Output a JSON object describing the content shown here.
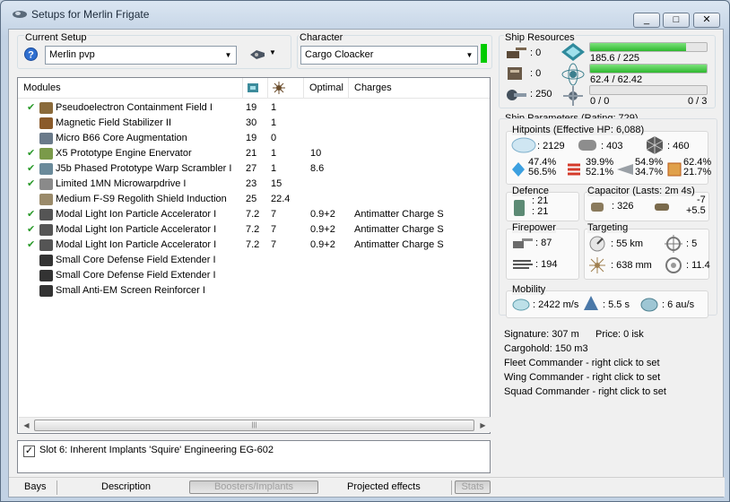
{
  "window": {
    "title": "Setups for Merlin Frigate",
    "min_label": "▭",
    "max_label": "▢",
    "close_label": "✕"
  },
  "setup": {
    "group_label": "Current Setup",
    "help_icon": "question-icon",
    "selected": "Merlin pvp"
  },
  "character": {
    "group_label": "Character",
    "selected": "Cargo Cloacker",
    "status_color": "#00cc00"
  },
  "modules": {
    "headers": {
      "name": "Modules",
      "col1": "",
      "col2": "",
      "optimal": "Optimal",
      "charges": "Charges"
    },
    "rows": [
      {
        "active": true,
        "icon": "module-icon",
        "name": "Pseudoelectron Containment Field I",
        "c1": "19",
        "c2": "1",
        "optimal": "",
        "charges": ""
      },
      {
        "active": false,
        "icon": "module-icon",
        "name": "Magnetic Field Stabilizer II",
        "c1": "30",
        "c2": "1",
        "optimal": "",
        "charges": ""
      },
      {
        "active": false,
        "icon": "module-icon",
        "name": "Micro B66 Core Augmentation",
        "c1": "19",
        "c2": "0",
        "optimal": "",
        "charges": ""
      },
      {
        "active": true,
        "icon": "module-icon",
        "name": "X5 Prototype Engine Enervator",
        "c1": "21",
        "c2": "1",
        "optimal": "10",
        "charges": ""
      },
      {
        "active": true,
        "icon": "module-icon",
        "name": "J5b Phased Prototype Warp Scrambler I",
        "c1": "27",
        "c2": "1",
        "optimal": "8.6",
        "charges": ""
      },
      {
        "active": true,
        "icon": "module-icon",
        "name": "Limited 1MN Microwarpdrive I",
        "c1": "23",
        "c2": "15",
        "optimal": "",
        "charges": ""
      },
      {
        "active": false,
        "icon": "module-icon",
        "name": "Medium F-S9 Regolith Shield Induction",
        "c1": "25",
        "c2": "22.4",
        "optimal": "",
        "charges": ""
      },
      {
        "active": true,
        "icon": "module-icon",
        "name": "Modal Light Ion Particle Accelerator I",
        "c1": "7.2",
        "c2": "7",
        "optimal": "0.9+2",
        "charges": "Antimatter Charge S"
      },
      {
        "active": true,
        "icon": "module-icon",
        "name": "Modal Light Ion Particle Accelerator I",
        "c1": "7.2",
        "c2": "7",
        "optimal": "0.9+2",
        "charges": "Antimatter Charge S"
      },
      {
        "active": true,
        "icon": "module-icon",
        "name": "Modal Light Ion Particle Accelerator I",
        "c1": "7.2",
        "c2": "7",
        "optimal": "0.9+2",
        "charges": "Antimatter Charge S"
      },
      {
        "active": false,
        "icon": "module-icon",
        "name": "Small Core Defense Field Extender I",
        "c1": "",
        "c2": "",
        "optimal": "",
        "charges": ""
      },
      {
        "active": false,
        "icon": "module-icon",
        "name": "Small Core Defense Field Extender I",
        "c1": "",
        "c2": "",
        "optimal": "",
        "charges": ""
      },
      {
        "active": false,
        "icon": "module-icon",
        "name": "Small Anti-EM Screen Reinforcer I",
        "c1": "",
        "c2": "",
        "optimal": "",
        "charges": ""
      }
    ]
  },
  "implant": {
    "checked": true,
    "label": "Slot 6: Inherent Implants 'Squire' Engineering EG-602"
  },
  "tabs": {
    "bays": "Bays",
    "description": "Description",
    "boosters": "Boosters/Implants",
    "projected": "Projected effects",
    "stats": "Stats"
  },
  "resources": {
    "group_label": "Ship Resources",
    "hardpoints": {
      "turret": ": 0",
      "launcher": ": 0",
      "drone": ": 250"
    },
    "cpu": {
      "text": "185.6 / 225",
      "fraction": 0.825
    },
    "pg": {
      "text": "62.4 / 62.42",
      "fraction": 0.9997
    },
    "drone_bw": {
      "text": "0 / 0",
      "right": "0 / 3",
      "fraction": 0
    }
  },
  "params": {
    "group_label": "Ship Parameters (Rating: 729)",
    "hitpoints": {
      "label": "Hitpoints (Effective HP: 6,088)",
      "shield": ": 2129",
      "armor": ": 403",
      "structure": ": 460",
      "shield_res": [
        "47.4%",
        "56.5%"
      ],
      "armor_res": [
        "39.9%",
        "52.1%"
      ],
      "kin_res": [
        "54.9%",
        "34.7%"
      ],
      "exp_res": [
        "62.4%",
        "21.7%"
      ]
    },
    "defence": {
      "label": "Defence",
      "v1": ": 21",
      "v2": ": 21"
    },
    "capacitor": {
      "label": "Capacitor (Lasts: 2m 4s)",
      "v1": ": 326",
      "v2": "-7",
      "v3": "+5.5"
    },
    "firepower": {
      "label": "Firepower",
      "v1": ": 87",
      "v2": ": 194"
    },
    "targeting": {
      "label": "Targeting",
      "range": ": 55 km",
      "targets": ": 5",
      "scan": ": 638 mm",
      "sig": ": 11.4"
    },
    "mobility": {
      "label": "Mobility",
      "speed": ": 2422 m/s",
      "align": ": 5.5 s",
      "warp": ": 6 au/s"
    }
  },
  "info": {
    "signature": "Signature: 307 m",
    "price": "Price: 0 isk",
    "cargohold": "Cargohold: 150 m3",
    "fleet": "Fleet Commander - right click to set",
    "wing": "Wing Commander - right click to set",
    "squad": "Squad Commander - right click to set"
  }
}
